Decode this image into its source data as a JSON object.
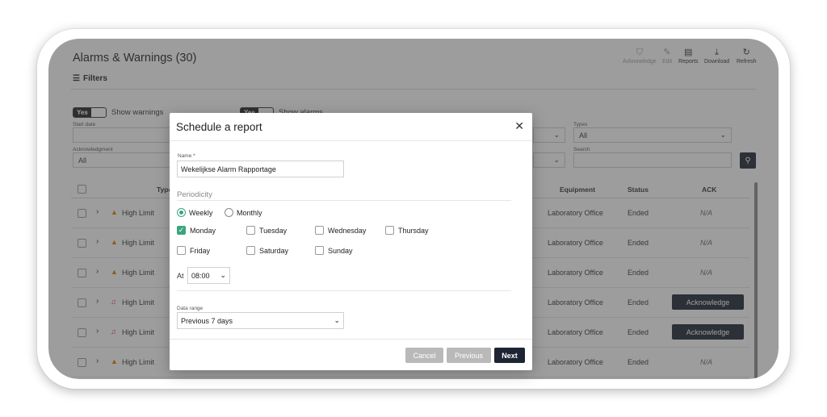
{
  "header": {
    "title": "Alarms & Warnings (30)",
    "filters_label": "Filters",
    "tools": [
      {
        "label": "Acknowledge",
        "icon": "shield-check-icon",
        "dim": true
      },
      {
        "label": "Edit",
        "icon": "pencil-icon",
        "dim": true
      },
      {
        "label": "Reports",
        "icon": "document-icon",
        "dim": false
      },
      {
        "label": "Download",
        "icon": "download-icon",
        "dim": false
      },
      {
        "label": "Refresh",
        "icon": "refresh-icon",
        "dim": false
      }
    ]
  },
  "filters": {
    "show_warnings": {
      "toggle": "Yes",
      "label": "Show warnings"
    },
    "show_alarms": {
      "toggle": "Yes",
      "label": "Show alarms"
    },
    "start_date_label": "Start date",
    "acknowledgment_label": "Acknowledgment",
    "acknowledgment_value": "All",
    "types_label": "Types",
    "types_value": "All",
    "search_label": "Search"
  },
  "table": {
    "headers": {
      "type": "Type",
      "equipment": "Equipment",
      "status": "Status",
      "ack": "ACK"
    },
    "rows": [
      {
        "icon": "warning-triangle-icon",
        "type": "High Limit",
        "equipment": "Laboratory Office",
        "status": "Ended",
        "ack": "N/A"
      },
      {
        "icon": "warning-triangle-icon",
        "type": "High Limit",
        "equipment": "Laboratory Office",
        "status": "Ended",
        "ack": "N/A"
      },
      {
        "icon": "warning-triangle-icon",
        "type": "High Limit",
        "equipment": "Laboratory Office",
        "status": "Ended",
        "ack": "N/A"
      },
      {
        "icon": "bell-icon",
        "type": "High Limit",
        "equipment": "Laboratory Office",
        "status": "Ended",
        "ack": "Acknowledge"
      },
      {
        "icon": "bell-icon",
        "type": "High Limit",
        "equipment": "Laboratory Office",
        "status": "Ended",
        "ack": "Acknowledge"
      },
      {
        "icon": "warning-triangle-icon",
        "type": "High Limit",
        "equipment": "Laboratory Office",
        "status": "Ended",
        "ack": "N/A"
      }
    ]
  },
  "modal": {
    "title": "Schedule a report",
    "name_label": "Name *",
    "name_value": "Wekelijkse Alarm Rapportage",
    "periodicity_label": "Periodicity",
    "weekly_label": "Weekly",
    "monthly_label": "Monthly",
    "days": [
      {
        "label": "Monday",
        "checked": true
      },
      {
        "label": "Tuesday",
        "checked": false
      },
      {
        "label": "Wednesday",
        "checked": false
      },
      {
        "label": "Thursday",
        "checked": false
      },
      {
        "label": "Friday",
        "checked": false
      },
      {
        "label": "Saturday",
        "checked": false
      },
      {
        "label": "Sunday",
        "checked": false
      }
    ],
    "at_label": "At",
    "at_value": "08:00",
    "data_range_label": "Data range",
    "data_range_value": "Previous 7 days",
    "cancel_label": "Cancel",
    "previous_label": "Previous",
    "next_label": "Next"
  },
  "colors": {
    "accent": "#3aa57d",
    "dark_button": "#1d2433",
    "warning": "#e07b00",
    "alarm": "#d33333"
  }
}
